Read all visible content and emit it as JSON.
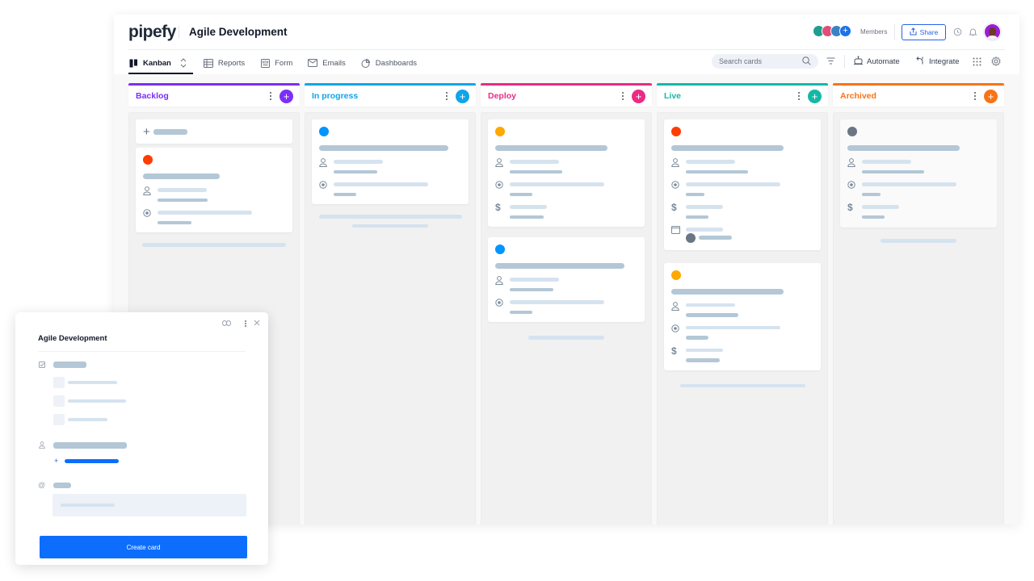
{
  "app": {
    "logo": "pipefy",
    "pipe_title": "Agile Development",
    "members_label": "Members",
    "share_label": "Share",
    "member_avatar_colors": [
      "#1d9e8f",
      "#e14d7a",
      "#3b82c4"
    ],
    "member_more": "+"
  },
  "nav": {
    "tabs": [
      {
        "label": "Kanban",
        "icon": "kanban-icon",
        "active": true
      },
      {
        "label": "Reports",
        "icon": "table-icon",
        "active": false
      },
      {
        "label": "Form",
        "icon": "form-icon",
        "active": false
      },
      {
        "label": "Emails",
        "icon": "mail-icon",
        "active": false
      },
      {
        "label": "Dashboards",
        "icon": "pie-chart-icon",
        "active": false
      }
    ],
    "search_placeholder": "Search cards",
    "automate_label": "Automate",
    "integrate_label": "Integrate"
  },
  "columns": [
    {
      "title": "Backlog",
      "color": "#7b2ff7"
    },
    {
      "title": "In progress",
      "color": "#0ea5e9"
    },
    {
      "title": "Deploy",
      "color": "#ec2a85"
    },
    {
      "title": "Live",
      "color": "#14b8a6"
    },
    {
      "title": "Archived",
      "color": "#f97316"
    }
  ],
  "label_colors": {
    "red": "#ff3d00",
    "blue": "#0095ff",
    "amber": "#ffa800",
    "gray": "#6b7684"
  },
  "panel": {
    "title": "Agile Development",
    "create_button": "Create card"
  }
}
